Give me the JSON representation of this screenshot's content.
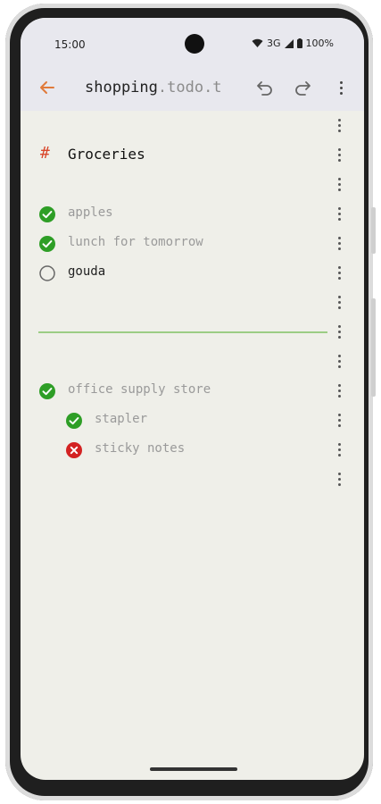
{
  "status": {
    "time": "15:00",
    "network": "3G",
    "battery": "100%"
  },
  "appbar": {
    "file_name": "shopping",
    "file_ext": ".todo.t"
  },
  "list": [
    {
      "kind": "blank"
    },
    {
      "kind": "heading",
      "marker": "#",
      "text": "Groceries"
    },
    {
      "kind": "blank"
    },
    {
      "kind": "task",
      "state": "done",
      "text": "apples"
    },
    {
      "kind": "task",
      "state": "done",
      "text": "lunch for tomorrow"
    },
    {
      "kind": "task",
      "state": "open",
      "text": "gouda"
    },
    {
      "kind": "blank"
    },
    {
      "kind": "separator"
    },
    {
      "kind": "blank"
    },
    {
      "kind": "task",
      "state": "done",
      "text": "office supply store"
    },
    {
      "kind": "subtask",
      "state": "done",
      "text": "stapler"
    },
    {
      "kind": "subtask",
      "state": "cancelled",
      "text": "sticky notes"
    },
    {
      "kind": "blank"
    }
  ],
  "colors": {
    "done": "#2e9e26",
    "cancelled": "#d32222",
    "accent": "#d9472b",
    "separator": "#9ccd84"
  }
}
